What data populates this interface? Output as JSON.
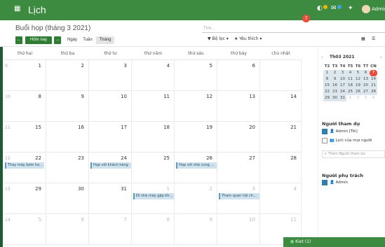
{
  "app": {
    "title": "Lịch",
    "user": "Admin"
  },
  "header": {
    "badge1": "5",
    "badge2": "2"
  },
  "breadcrumb": "Buổi họp (tháng 3 2021)",
  "nav": {
    "today": "Hôm nay",
    "day": "Ngày",
    "week": "Tuần",
    "month": "Tháng"
  },
  "search": {
    "placeholder": "Tìm..."
  },
  "filters": {
    "filter": "Bộ lọc",
    "favorites": "Yêu thích"
  },
  "weekdays": [
    "thứ hai",
    "thứ ba",
    "thứ tư",
    "thứ năm",
    "thứ sáu",
    "thứ bảy",
    "chủ nhật"
  ],
  "weeks": [
    {
      "num": "9",
      "days": [
        "1",
        "2",
        "3",
        "4",
        "5",
        "6",
        "7"
      ]
    },
    {
      "num": "10",
      "days": [
        "8",
        "9",
        "10",
        "11",
        "12",
        "13",
        "14"
      ]
    },
    {
      "num": "11",
      "days": [
        "15",
        "16",
        "17",
        "18",
        "19",
        "20",
        "21"
      ]
    },
    {
      "num": "12",
      "days": [
        "22",
        "23",
        "24",
        "25",
        "26",
        "27",
        "28"
      ]
    },
    {
      "num": "13",
      "days": [
        "29",
        "30",
        "31",
        "1",
        "2",
        "3",
        "4"
      ]
    },
    {
      "num": "14",
      "days": [
        "5",
        "6",
        "7",
        "8",
        "9",
        "10",
        "11"
      ]
    }
  ],
  "events": [
    {
      "label": "Thay máy bơm ho..."
    },
    {
      "label": "Họp với khách hàng"
    },
    {
      "label": "Họp với nhà cung ..."
    },
    {
      "label": "Đi nhà máy gặp kh..."
    },
    {
      "label": "Tham quan hội ch..."
    }
  ],
  "mini": {
    "title": "Th03 2021",
    "headers": [
      "T2",
      "T3",
      "T4",
      "T5",
      "T6",
      "T7",
      "CN"
    ],
    "rows": [
      [
        "1",
        "2",
        "3",
        "4",
        "5",
        "6",
        "7"
      ],
      [
        "8",
        "9",
        "10",
        "11",
        "12",
        "13",
        "14"
      ],
      [
        "15",
        "16",
        "17",
        "18",
        "19",
        "20",
        "21"
      ],
      [
        "22",
        "23",
        "24",
        "25",
        "26",
        "27",
        "28"
      ],
      [
        "29",
        "30",
        "31",
        "1",
        "2",
        "3",
        "4"
      ]
    ]
  },
  "attendees": {
    "title": "Người tham dự",
    "me": "Admin [Tôi]",
    "everyone": "Lịch của mọi người",
    "add": "+ Thêm Người tham dự"
  },
  "responsible": {
    "title": "Người phụ trách",
    "name": "Admin"
  },
  "chat": {
    "label": "Kiet (1)"
  }
}
